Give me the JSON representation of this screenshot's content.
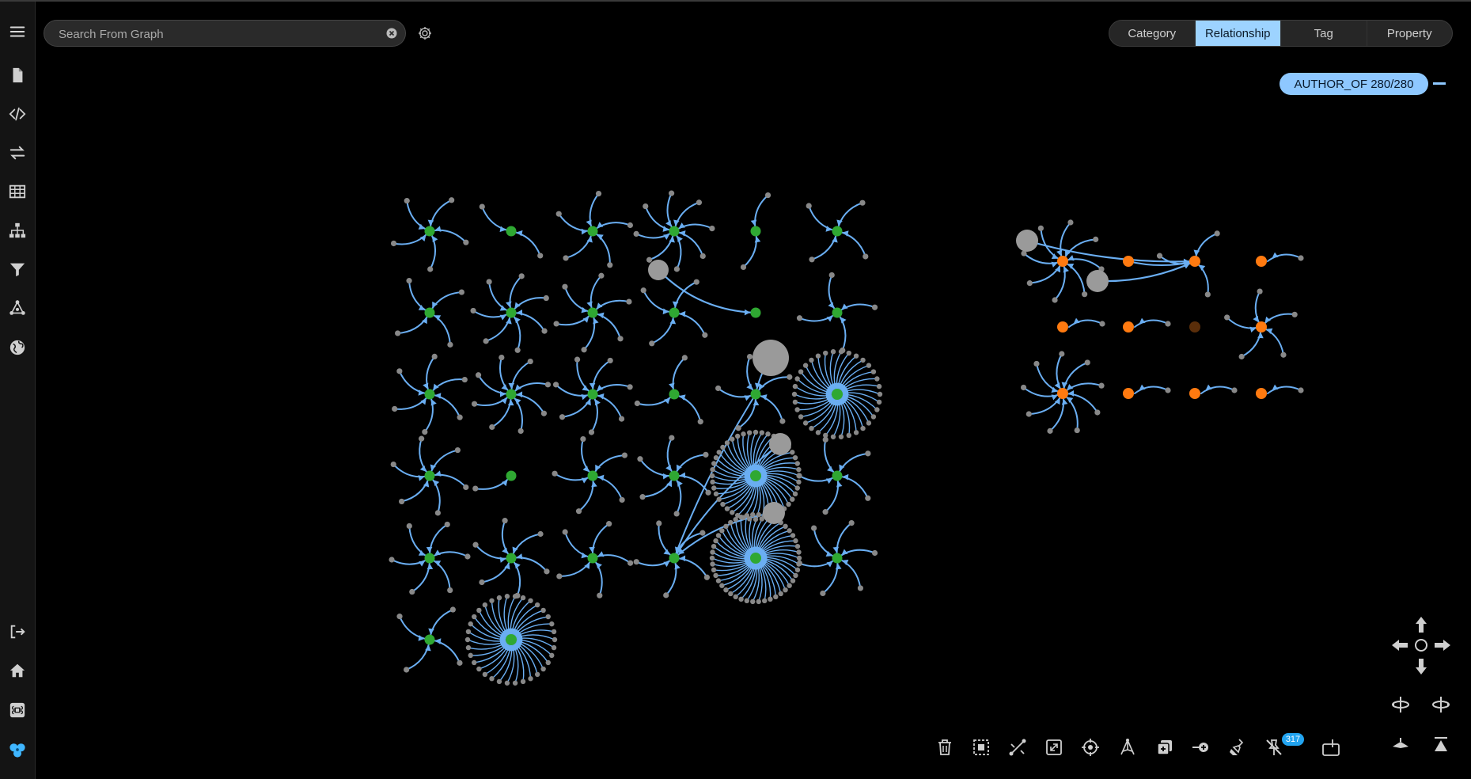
{
  "search": {
    "placeholder": "Search From Graph",
    "value": ""
  },
  "view_tabs": [
    {
      "label": "Category",
      "active": false
    },
    {
      "label": "Relationship",
      "active": true
    },
    {
      "label": "Tag",
      "active": false
    },
    {
      "label": "Property",
      "active": false
    }
  ],
  "legend": {
    "label": "AUTHOR_OF 280/280",
    "color": "#8ec8ff"
  },
  "sidebar": {
    "top_items": [
      "menu-icon",
      "document-icon",
      "code-icon",
      "swap-icon",
      "table-icon",
      "hierarchy-icon",
      "filter-icon",
      "graph-icon",
      "globe-icon"
    ],
    "bottom_items": [
      "logout-icon",
      "home-icon",
      "command-icon",
      "nodes-app-icon"
    ]
  },
  "toolbar": {
    "tools": [
      "delete-icon",
      "select-box-icon",
      "shortest-path-icon",
      "fit-view-icon",
      "focus-icon",
      "layout-icon",
      "expand-icon",
      "connect-icon",
      "clean-icon",
      "hide-unpinned-icon",
      "pin-icon"
    ],
    "badge_count": "317"
  },
  "navigation": {
    "controls": [
      "pan-up-icon",
      "pan-left-icon",
      "center-icon",
      "pan-right-icon",
      "pan-down-icon",
      "rotate-left-icon",
      "rotate-right-icon",
      "tilt-down-icon",
      "tilt-up-icon"
    ]
  },
  "graph_colors": {
    "edge": "#6aaef2",
    "leaf_node": "#888888",
    "hub_node": "#2fa832",
    "cluster_node": "#ff7a10",
    "large_node": "#9a9a9a"
  }
}
